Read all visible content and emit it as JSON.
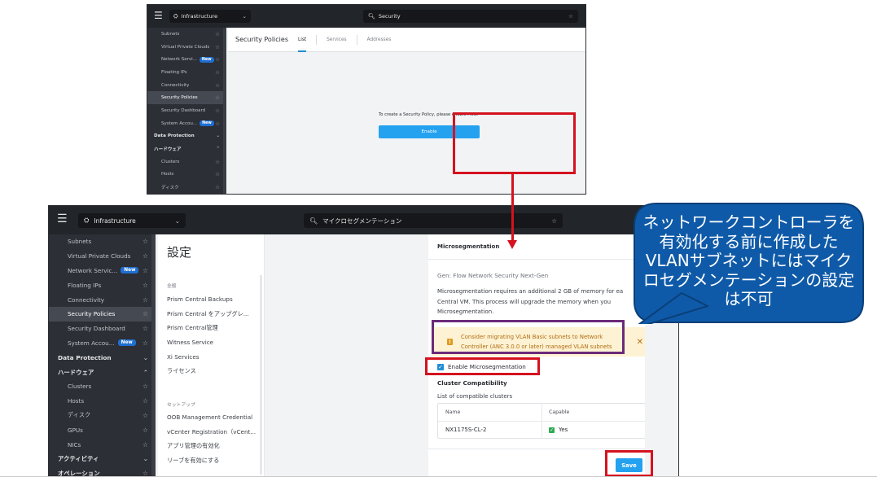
{
  "shot1": {
    "app_selector": "Infrastructure",
    "search_value": "Security",
    "sidebar": [
      {
        "label": "Subnets",
        "kind": "sub",
        "star": true
      },
      {
        "label": "Virtual Private Clouds",
        "kind": "sub",
        "star": true
      },
      {
        "label": "Network Servi...",
        "kind": "sub",
        "badge": "New",
        "star": true
      },
      {
        "label": "Floating IPs",
        "kind": "sub",
        "star": true
      },
      {
        "label": "Connectivity",
        "kind": "sub",
        "star": true
      },
      {
        "label": "Security Policies",
        "kind": "sub",
        "star": true,
        "active": true
      },
      {
        "label": "Security Dashboard",
        "kind": "sub",
        "star": true
      },
      {
        "label": "System Accou...",
        "kind": "sub",
        "badge": "New",
        "star": true
      },
      {
        "label": "Data Protection",
        "kind": "sec",
        "chevron": "⌄"
      },
      {
        "label": "ハードウェア",
        "kind": "sec",
        "chevron": "⌃"
      },
      {
        "label": "Clusters",
        "kind": "sub",
        "star": true
      },
      {
        "label": "Hosts",
        "kind": "sub",
        "star": true
      },
      {
        "label": "ディスク",
        "kind": "sub",
        "star": true
      }
    ],
    "page_title": "Security Policies",
    "tabs": [
      "List",
      "Services",
      "Addresses"
    ],
    "active_tab": 0,
    "flow_message": "To create a Security Policy, please enable Flow.",
    "enable_label": "Enable"
  },
  "shot2": {
    "app_selector": "Infrastructure",
    "search_value": "マイクロセグメンテーション",
    "sidebar": [
      {
        "label": "Subnets",
        "kind": "sub",
        "star": true
      },
      {
        "label": "Virtual Private Clouds",
        "kind": "sub",
        "star": true
      },
      {
        "label": "Network Servic...",
        "kind": "sub",
        "badge": "New",
        "star": true
      },
      {
        "label": "Floating IPs",
        "kind": "sub",
        "star": true
      },
      {
        "label": "Connectivity",
        "kind": "sub",
        "star": true
      },
      {
        "label": "Security Policies",
        "kind": "sub",
        "star": true,
        "active": true
      },
      {
        "label": "Security Dashboard",
        "kind": "sub",
        "star": true
      },
      {
        "label": "System Accou...",
        "kind": "sub",
        "badge": "New",
        "star": true
      },
      {
        "label": "Data Protection",
        "kind": "sec",
        "chevron": "⌄"
      },
      {
        "label": "ハードウェア",
        "kind": "sec",
        "chevron": "⌃"
      },
      {
        "label": "Clusters",
        "kind": "sub",
        "star": true
      },
      {
        "label": "Hosts",
        "kind": "sub",
        "star": true
      },
      {
        "label": "ディスク",
        "kind": "sub",
        "star": true
      },
      {
        "label": "GPUs",
        "kind": "sub",
        "star": true
      },
      {
        "label": "NICs",
        "kind": "sub",
        "star": true
      },
      {
        "label": "アクティビティ",
        "kind": "sec",
        "chevron": "⌄"
      },
      {
        "label": "オペレーション",
        "kind": "sec",
        "star": true
      }
    ],
    "settings": {
      "title": "設定",
      "group_general": "全般",
      "general_items": [
        "Prism Central Backups",
        "Prism Central をアップグレ...",
        "Prism Central管理",
        "Witness Service",
        "Xi Services",
        "ライセンス"
      ],
      "group_setup": "セットアップ",
      "setup_items": [
        "OOB Management Credential",
        "vCenter Registration（vCent...",
        "アプリ管理の有効化",
        "リーブを有効にする"
      ]
    },
    "panel": {
      "title": "Microsegmentation",
      "generation": "Gen: Flow Network Security Next-Gen",
      "description": "Microsegmentation requires an additional 2 GB of memory for ea Central VM. This process will upgrade the memory when you Microsegmentation.",
      "warning": "Consider migrating VLAN Basic subnets to Network Controller (ANC 3.0.0 or later) managed VLAN subnets",
      "checkbox_label": "Enable Microsegmentation",
      "compat_title": "Cluster Compatibility",
      "compat_list_label": "List of compatible clusters",
      "table": {
        "headers": [
          "Name",
          "Capable"
        ],
        "rows": [
          {
            "name": "NX1175S-CL-2",
            "capable": "Yes"
          }
        ]
      },
      "save_label": "Save"
    }
  },
  "callout": {
    "text": "ネットワークコントローラを有効化する前に作成したVLANサブネットにはマイクロセグメンテーションの設定は不可"
  },
  "colors": {
    "accent_blue": "#24a2f0",
    "highlight_red": "#d5121f",
    "highlight_purple": "#6b2a7a",
    "callout_blue": "#0f5aa8",
    "warning_text": "#b36b12",
    "warning_bg": "#fdf2d3"
  }
}
